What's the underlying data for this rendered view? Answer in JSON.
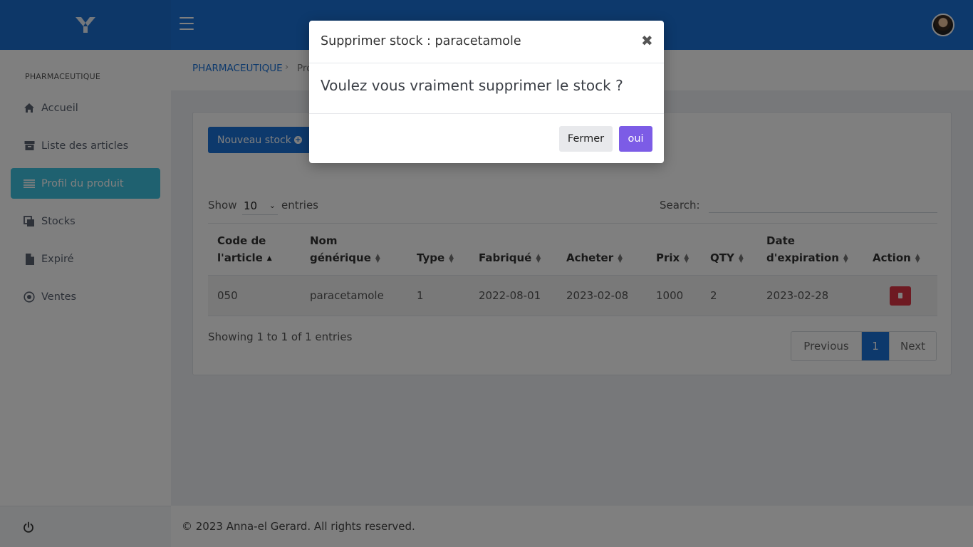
{
  "colors": {
    "primary": "#1a73d9",
    "active_nav": "#3fc3e0",
    "danger": "#dc3545",
    "confirm": "#7c5ce6"
  },
  "header": {
    "logo_icon": "brand-logo-icon",
    "menu_icon": "hamburger-icon",
    "avatar_icon": "user-avatar"
  },
  "sidebar": {
    "section_title": "PHARMACEUTIQUE",
    "items": [
      {
        "label": "Accueil",
        "icon": "home-icon",
        "active": false
      },
      {
        "label": "Liste des articles",
        "icon": "archive-icon",
        "active": false
      },
      {
        "label": "Profil du produit",
        "icon": "list-icon",
        "active": true
      },
      {
        "label": "Stocks",
        "icon": "copy-icon",
        "active": false
      },
      {
        "label": "Expiré",
        "icon": "file-icon",
        "active": false
      },
      {
        "label": "Ventes",
        "icon": "dot-circle-icon",
        "active": false
      }
    ],
    "footer_icon": "power-icon"
  },
  "breadcrumb": {
    "root": "PHARMACEUTIQUE",
    "current": "Pro"
  },
  "main": {
    "new_button": "Nouveau stock",
    "show_label": "Show",
    "page_length": "10",
    "entries_label": "entries",
    "search_label": "Search:",
    "search_value": "",
    "table": {
      "headers": [
        {
          "line1": "Code de",
          "line2": "l'article"
        },
        {
          "line1": "Nom",
          "line2": "générique"
        },
        {
          "line1": "",
          "line2": "Type"
        },
        {
          "line1": "",
          "line2": "Fabriqué"
        },
        {
          "line1": "",
          "line2": "Acheter"
        },
        {
          "line1": "",
          "line2": "Prix"
        },
        {
          "line1": "",
          "line2": "QTY"
        },
        {
          "line1": "Date",
          "line2": "d'expiration"
        },
        {
          "line1": "",
          "line2": "Action"
        }
      ],
      "rows": [
        {
          "code": "050",
          "nom": "paracetamole",
          "type": "1",
          "fabrique": "2022-08-01",
          "acheter": "2023-02-08",
          "prix": "1000",
          "qty": "2",
          "expiration": "2023-02-28"
        }
      ]
    },
    "showing": "Showing 1 to 1 of 1 entries",
    "pagination": {
      "previous": "Previous",
      "page": "1",
      "next": "Next"
    }
  },
  "footer": {
    "copyright": "© 2023 Anna-el Gerard. All rights reserved."
  },
  "modal": {
    "title": "Supprimer stock : paracetamole",
    "close_symbol": "✖",
    "body": "Voulez vous vraiment supprimer le stock ?",
    "cancel_button": "Fermer",
    "confirm_button": "oui"
  }
}
